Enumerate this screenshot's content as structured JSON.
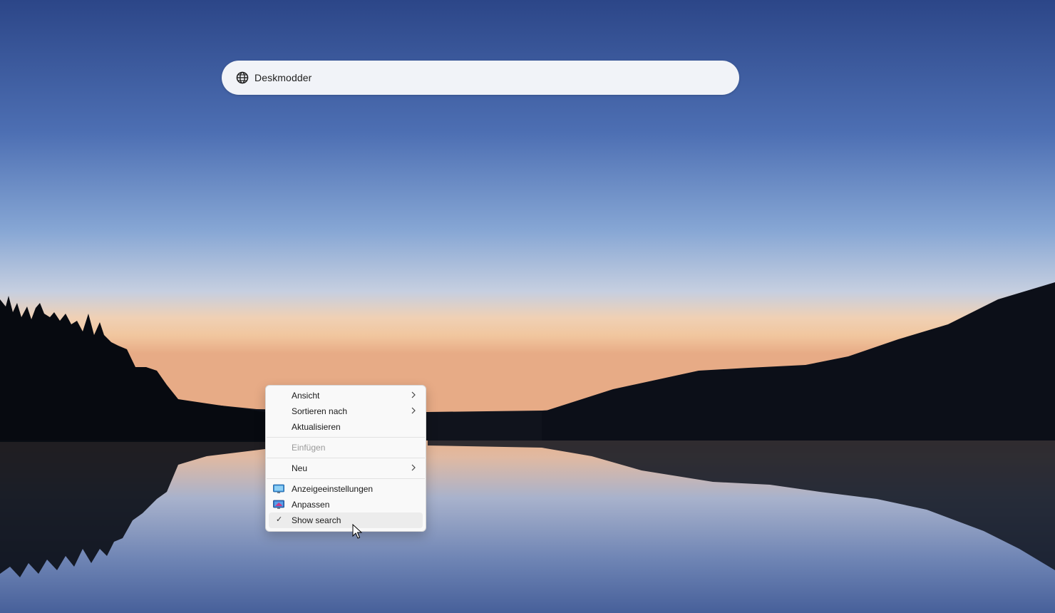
{
  "search": {
    "icon": "globe-search-icon",
    "query": "Deskmodder"
  },
  "context_menu": {
    "items": [
      {
        "label": "Ansicht",
        "submenu": true
      },
      {
        "label": "Sortieren nach",
        "submenu": true
      },
      {
        "label": "Aktualisieren"
      },
      {
        "label": "Einfügen",
        "disabled": true
      },
      {
        "label": "Neu",
        "submenu": true
      },
      {
        "label": "Anzeigeeinstellungen",
        "icon": "display-settings-icon"
      },
      {
        "label": "Anpassen",
        "icon": "personalize-icon"
      },
      {
        "label": "Show search",
        "checked": true,
        "check_glyph": "✓"
      }
    ]
  },
  "colors": {
    "menu_bg": "#f9f9f9",
    "search_bg": "#f1f3f8",
    "sky_top": "#2f4a8c",
    "horizon": "#f2c69d"
  }
}
